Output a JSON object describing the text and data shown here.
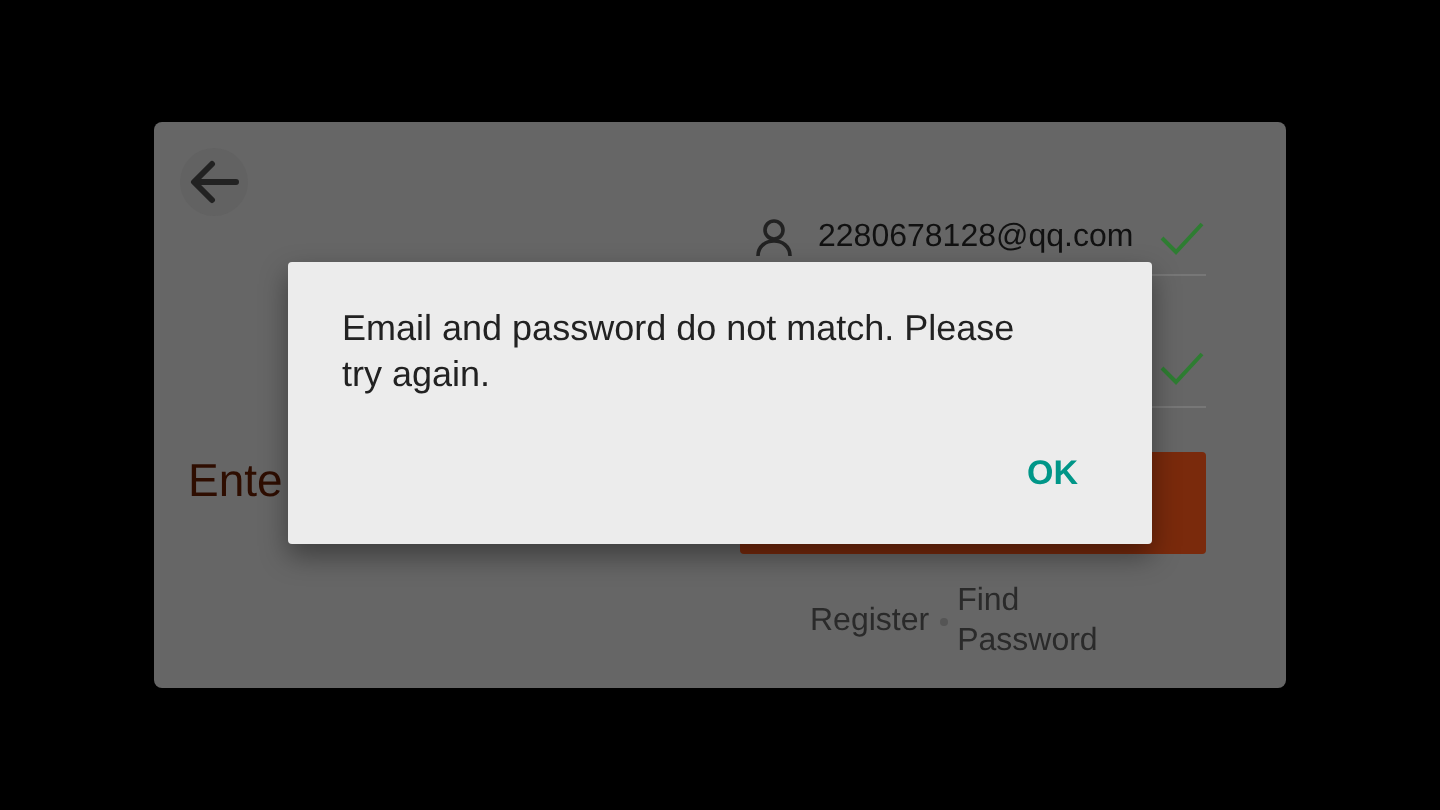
{
  "login": {
    "title": "Ente",
    "fields": [
      {
        "kind": "email",
        "value": "2280678128@qq.com",
        "valid": true
      },
      {
        "kind": "password",
        "valid": true
      }
    ],
    "links": [
      "Register",
      "Find Password"
    ]
  },
  "dialog": {
    "message": "Email and password do not match. Please try again.",
    "button": "OK"
  }
}
